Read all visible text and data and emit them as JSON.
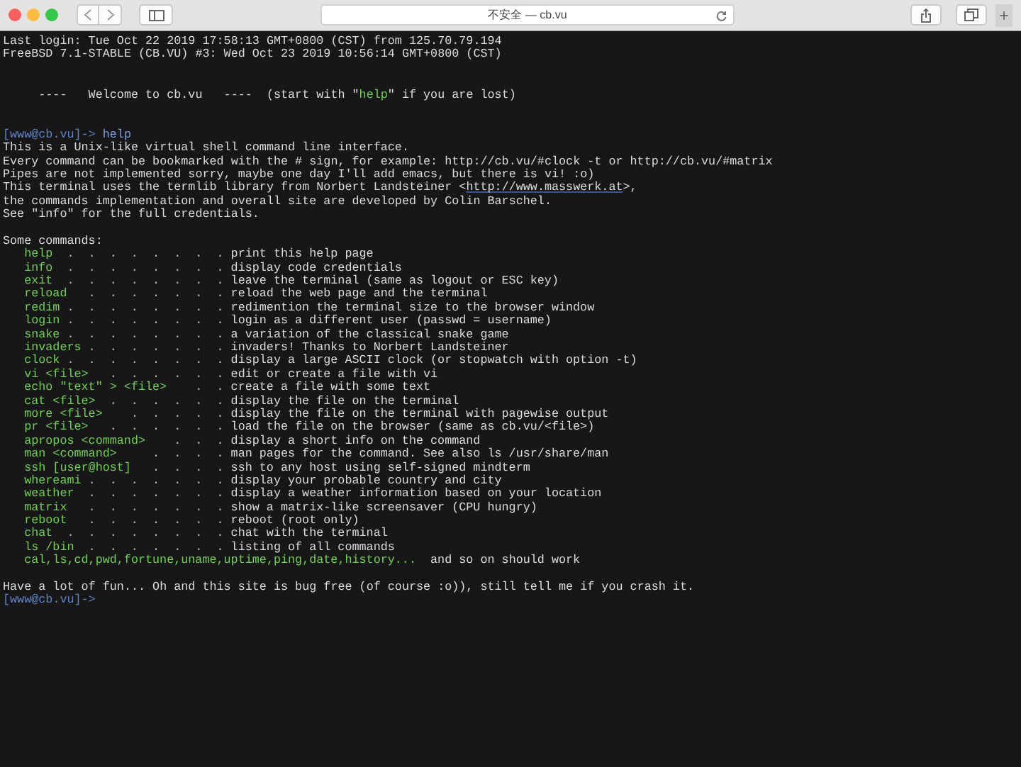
{
  "browser": {
    "address": "不安全 — cb.vu",
    "new_tab": "+"
  },
  "terminal": {
    "lines": [
      {
        "kind": "text",
        "text": "Last login: Tue Oct 22 2019 17:58:13 GMT+0800 (CST) from 125.70.79.194"
      },
      {
        "kind": "text",
        "text": "FreeBSD 7.1-STABLE (CB.VU) #3: Wed Oct 23 2019 10:56:14 GMT+0800 (CST)"
      },
      {
        "kind": "blank"
      },
      {
        "kind": "blank"
      },
      {
        "kind": "welcome",
        "before": "     ----   Welcome to cb.vu   ----  (start with \"",
        "highlight": "help",
        "after": "\" if you are lost)"
      },
      {
        "kind": "blank"
      },
      {
        "kind": "blank"
      },
      {
        "kind": "prompt",
        "prompt": "[www@cb.vu]->",
        "command": " help"
      },
      {
        "kind": "text",
        "text": "This is a Unix-like virtual shell command line interface."
      },
      {
        "kind": "text",
        "text": "Every command can be bookmarked with the # sign, for example: http://cb.vu/#clock -t or http://cb.vu/#matrix"
      },
      {
        "kind": "text",
        "text": "Pipes are not implemented sorry, maybe one day I'll add emacs, but there is vi! :o)"
      },
      {
        "kind": "link",
        "before": "This terminal uses the termlib library from Norbert Landsteiner <",
        "link": "http://www.masswerk.at",
        "after": ">,"
      },
      {
        "kind": "text",
        "text": "the commands implementation and overall site are developed by Colin Barschel."
      },
      {
        "kind": "text",
        "text": "See \"info\" for the full credentials."
      },
      {
        "kind": "blank"
      },
      {
        "kind": "text",
        "text": "Some commands:"
      },
      {
        "kind": "command",
        "name": "help",
        "dots": ".  .  .  .  .  .  .  .",
        "desc": "print this help page"
      },
      {
        "kind": "command",
        "name": "info",
        "dots": ".  .  .  .  .  .  .  .",
        "desc": "display code credentials"
      },
      {
        "kind": "command",
        "name": "exit",
        "dots": ".  .  .  .  .  .  .  .",
        "desc": "leave the terminal (same as logout or ESC key)"
      },
      {
        "kind": "command",
        "name": "reload",
        "dots": ".  .  .  .  .  .  .",
        "desc": "reload the web page and the terminal"
      },
      {
        "kind": "command",
        "name": "redim",
        "dots": ".  .  .  .  .  .  .  .",
        "desc": "redimention the terminal size to the browser window"
      },
      {
        "kind": "command",
        "name": "login",
        "dots": ".  .  .  .  .  .  .  .",
        "desc": "login as a different user (passwd = username)"
      },
      {
        "kind": "command",
        "name": "snake",
        "dots": ".  .  .  .  .  .  .  .",
        "desc": "a variation of the classical snake game"
      },
      {
        "kind": "command",
        "name": "invaders",
        "dots": ".  .  .  .  .  .  .",
        "desc": "invaders! Thanks to Norbert Landsteiner"
      },
      {
        "kind": "command",
        "name": "clock",
        "dots": ".  .  .  .  .  .  .  .",
        "desc": "display a large ASCII clock (or stopwatch with option -t)"
      },
      {
        "kind": "command",
        "name": "vi <file>",
        "dots": ".  .  .  .  .  .",
        "desc": "edit or create a file with vi"
      },
      {
        "kind": "command",
        "name": "echo \"text\" > <file>",
        "dots": ".  .",
        "desc": "create a file with some text"
      },
      {
        "kind": "command",
        "name": "cat <file>",
        "dots": ".  .  .  .  .  .",
        "desc": "display the file on the terminal"
      },
      {
        "kind": "command",
        "name": "more <file>",
        "dots": ".  .  .  .  .",
        "desc": "display the file on the terminal with pagewise output"
      },
      {
        "kind": "command",
        "name": "pr <file>",
        "dots": ".  .  .  .  .  .",
        "desc": "load the file on the browser (same as cb.vu/<file>)"
      },
      {
        "kind": "command",
        "name": "apropos <command>",
        "dots": ".  .  .",
        "desc": "display a short info on the command"
      },
      {
        "kind": "command",
        "name": "man <command>",
        "dots": ".  .  .  .",
        "desc": "man pages for the command. See also ls /usr/share/man"
      },
      {
        "kind": "command",
        "name": "ssh [user@host]",
        "dots": ".  .  .  .",
        "desc": "ssh to any host using self-signed mindterm"
      },
      {
        "kind": "command",
        "name": "whereami",
        "dots": ".  .  .  .  .  .  .",
        "desc": "display your probable country and city"
      },
      {
        "kind": "command",
        "name": "weather",
        "dots": ".  .  .  .  .  .  .",
        "desc": "display a weather information based on your location"
      },
      {
        "kind": "command",
        "name": "matrix",
        "dots": ".  .  .  .  .  .  .",
        "desc": "show a matrix-like screensaver (CPU hungry)"
      },
      {
        "kind": "command",
        "name": "reboot",
        "dots": ".  .  .  .  .  .  .",
        "desc": "reboot (root only)"
      },
      {
        "kind": "command",
        "name": "chat",
        "dots": ".  .  .  .  .  .  .  .",
        "desc": "chat with the terminal"
      },
      {
        "kind": "command",
        "name": "ls /bin",
        "dots": ".  .  .  .  .  .  .",
        "desc": "listing of all commands"
      },
      {
        "kind": "extra",
        "name": "cal,ls,cd,pwd,fortune,uname,uptime,ping,date,history...",
        "desc": "and so on should work"
      },
      {
        "kind": "blank"
      },
      {
        "kind": "text",
        "text": "Have a lot of fun... Oh and this site is bug free (of course :o)), still tell me if you crash it."
      },
      {
        "kind": "prompt",
        "prompt": "[www@cb.vu]->"
      }
    ]
  }
}
